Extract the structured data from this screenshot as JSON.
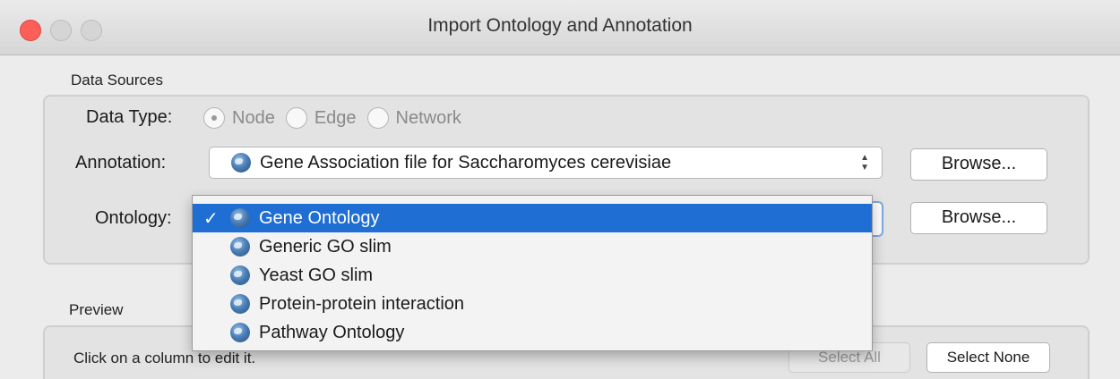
{
  "window": {
    "title": "Import Ontology and Annotation"
  },
  "data_sources": {
    "section_label": "Data Sources",
    "data_type": {
      "label": "Data Type:",
      "options": [
        {
          "label": "Node",
          "checked": true
        },
        {
          "label": "Edge",
          "checked": false
        },
        {
          "label": "Network",
          "checked": false
        }
      ]
    },
    "annotation": {
      "label": "Annotation:",
      "value": "Gene Association file for Saccharomyces cerevisiae",
      "icon": "globe-icon",
      "browse_label": "Browse..."
    },
    "ontology": {
      "label": "Ontology:",
      "icon": "globe-icon",
      "browse_label": "Browse...",
      "dropdown_open": true,
      "options": [
        {
          "label": "Gene Ontology",
          "selected": true
        },
        {
          "label": "Generic GO slim",
          "selected": false
        },
        {
          "label": "Yeast GO slim",
          "selected": false
        },
        {
          "label": "Protein-protein interaction",
          "selected": false
        },
        {
          "label": "Pathway Ontology",
          "selected": false
        }
      ],
      "check_mark": "✓"
    }
  },
  "preview": {
    "section_label": "Preview",
    "hint": "Click on a column to edit it.",
    "select_all_label": "Select All",
    "select_all_enabled": false,
    "select_none_label": "Select None"
  },
  "colors": {
    "selection": "#1f6ed4",
    "close_button": "#fc5f57",
    "focus_ring": "#7ea9e1"
  }
}
